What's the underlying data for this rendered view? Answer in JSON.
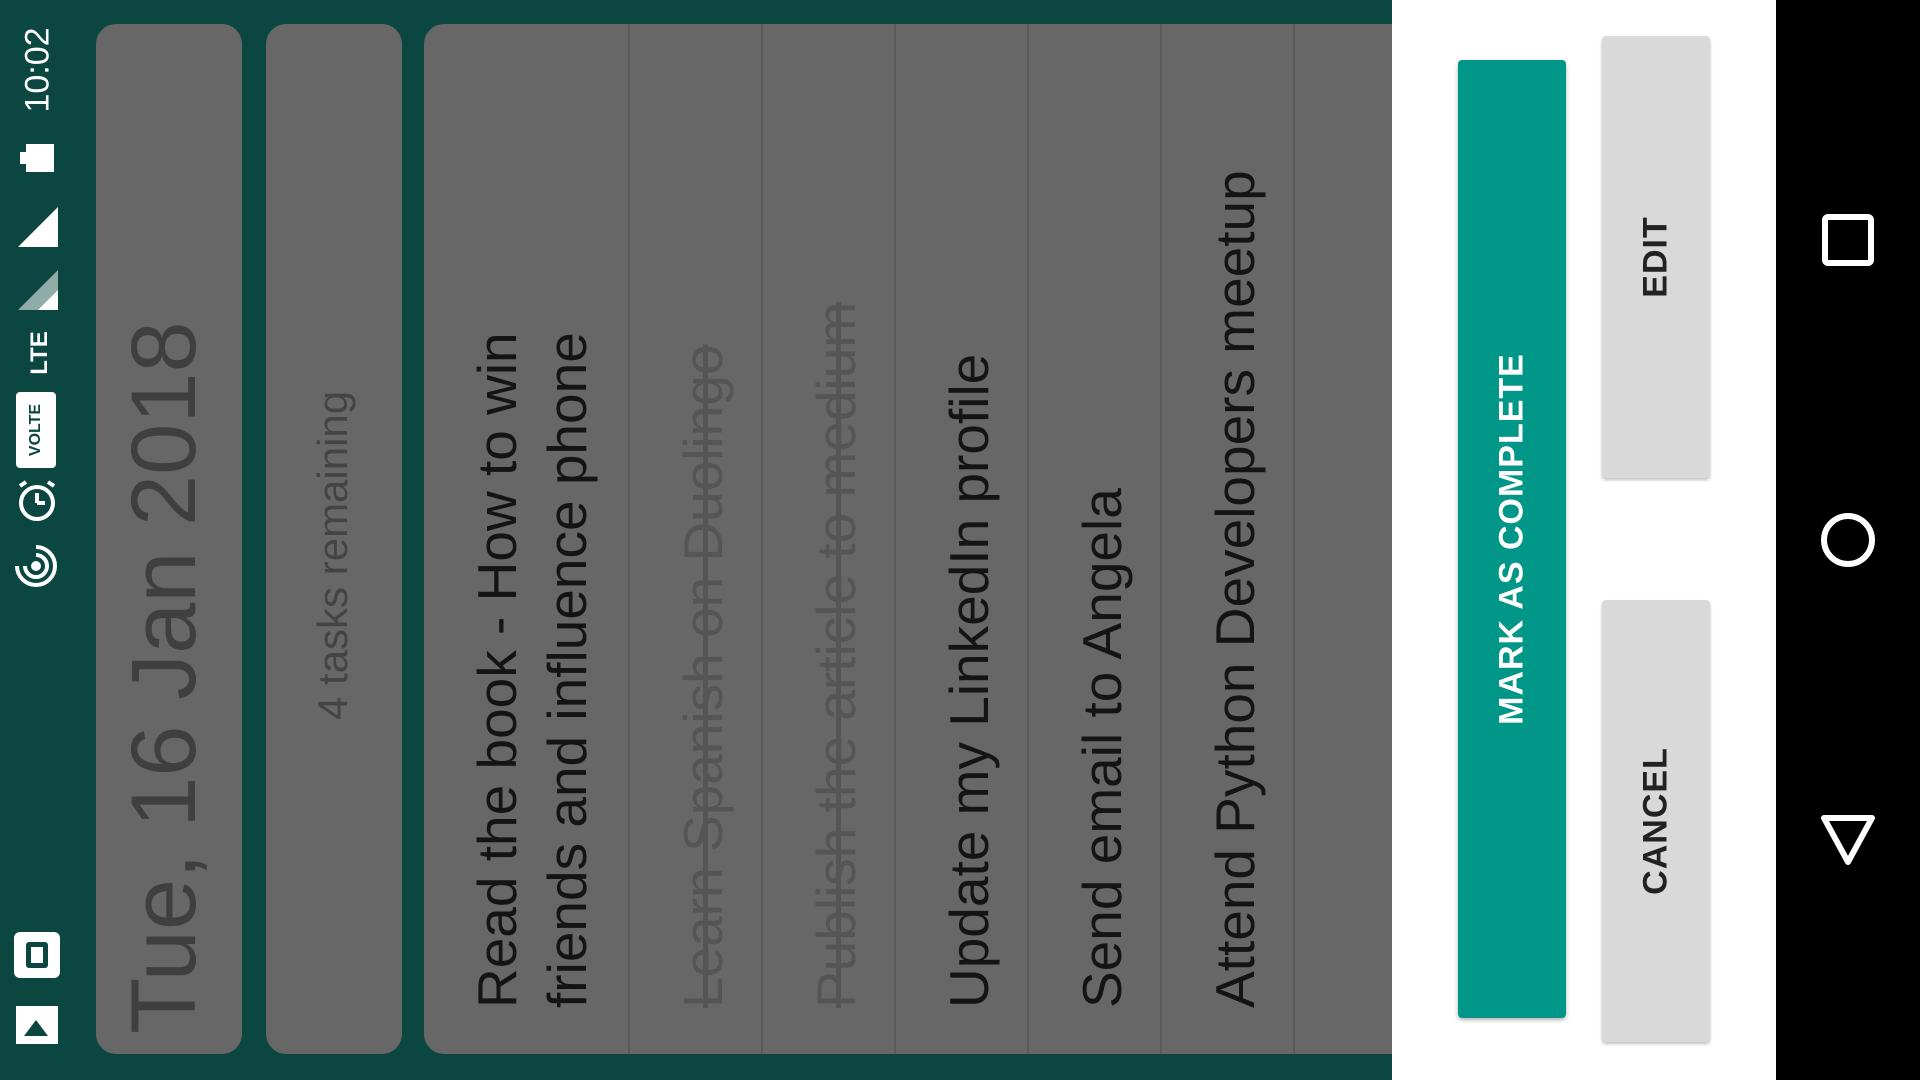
{
  "status_bar": {
    "time": "10:02",
    "network_label": "LTE",
    "volte_label": "VOLTE",
    "icons": [
      "photo-icon",
      "app-notification-icon",
      "hotspot-icon",
      "alarm-icon",
      "volte-icon",
      "lte-data-icon",
      "signal-icon",
      "signal-icon",
      "battery-icon"
    ]
  },
  "header": {
    "date": "Tue, 16 Jan 2018",
    "remaining": "4 tasks remaining"
  },
  "tasks": [
    {
      "title": "Read the book - How to win friends and influence phone",
      "line1": "Read the book - How to win",
      "line2": "friends and influence phone",
      "done": false
    },
    {
      "title": "Learn Spanish on Duolingo",
      "done": true
    },
    {
      "title": "Publish the article to medium",
      "done": true
    },
    {
      "title": "Update my LinkedIn profile",
      "done": false
    },
    {
      "title": "Send email to Angela",
      "done": false
    },
    {
      "title": "Attend Python Developers meetup",
      "done": false
    }
  ],
  "sheet": {
    "mark_complete": "MARK AS COMPLETE",
    "edit": "EDIT",
    "cancel": "CANCEL"
  },
  "nav": {
    "icons": [
      "recents-icon",
      "home-icon",
      "back-icon"
    ]
  },
  "colors": {
    "status_bar": "#0b4740",
    "accent": "#009688",
    "scrim_card": "#676767",
    "flat_button": "#d9d9d9"
  }
}
